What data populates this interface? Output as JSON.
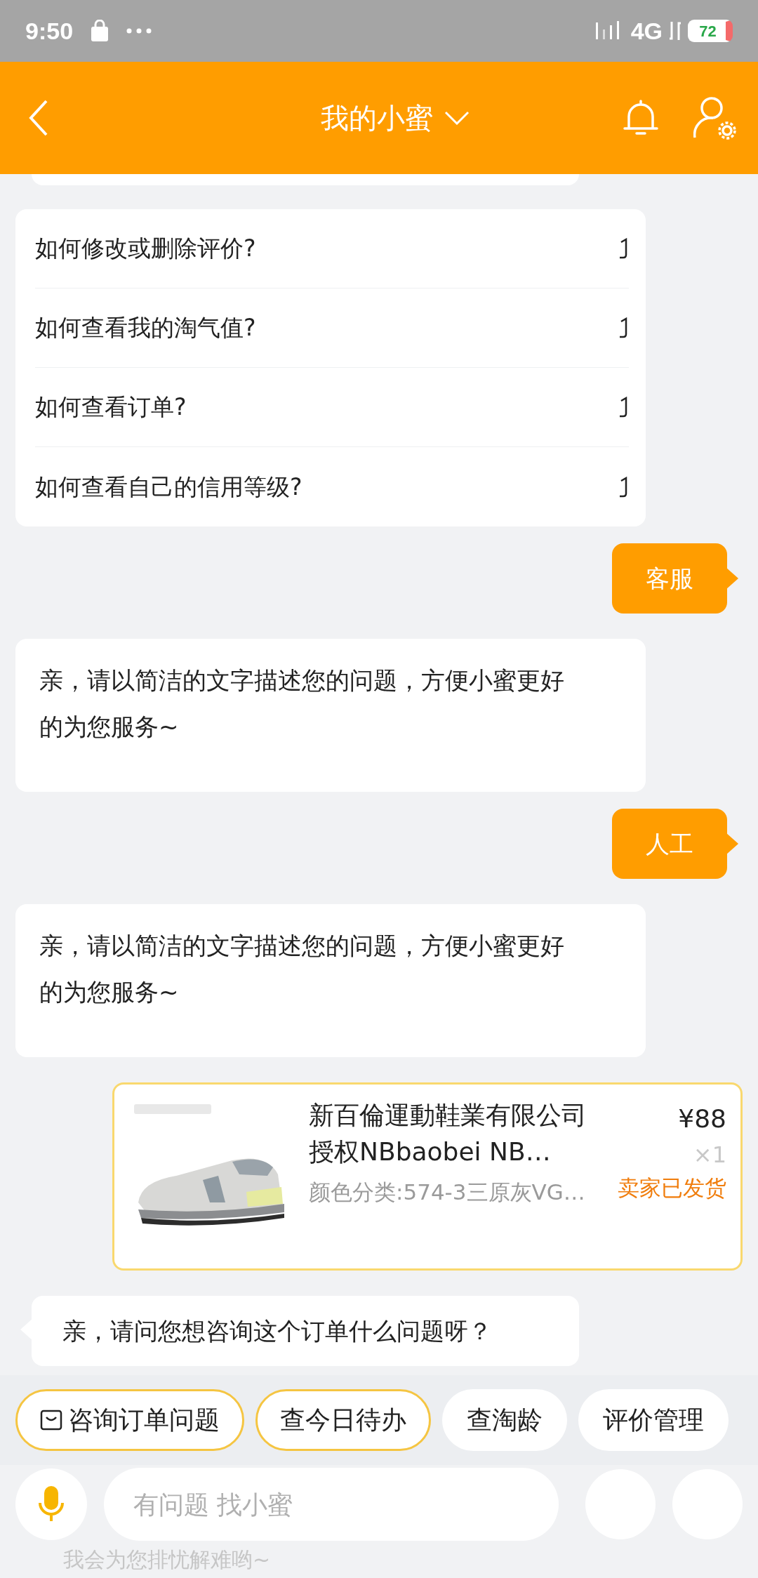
{
  "status_bar": {
    "time": "9:50",
    "network": "4G",
    "battery": "72"
  },
  "header": {
    "title": "我的小蜜"
  },
  "messages": [
    {
      "kind": "faq",
      "questions": [
        "如何修改或删除评价?",
        "如何查看我的淘气值?",
        "如何查看订单?",
        "如何查看自己的信用等级?"
      ]
    },
    {
      "kind": "user",
      "text": "客服"
    },
    {
      "kind": "bot",
      "text": "亲，请以简洁的文字描述您的问题，方便小蜜更好的为您服务~"
    },
    {
      "kind": "user",
      "text": "人工"
    },
    {
      "kind": "bot",
      "text": "亲，请以简洁的文字描述您的问题，方便小蜜更好的为您服务~"
    },
    {
      "kind": "order",
      "title": "新百倫運動鞋業有限公司授权NBbaobei NB…",
      "sku": "颜色分类:574-3三原灰VG…",
      "price": "¥88",
      "quantity": "×1",
      "status": "卖家已发货"
    },
    {
      "kind": "bot_short",
      "text": "亲，请问您想咨询这个订单什么问题呀？"
    }
  ],
  "quick_replies": [
    {
      "label": "咨询订单问题",
      "kind": "icon",
      "highlighted": true
    },
    {
      "label": "查今日待办",
      "kind": "plain",
      "highlighted": true
    },
    {
      "label": "查淘龄",
      "kind": "plain",
      "highlighted": false
    },
    {
      "label": "评价管理",
      "kind": "plain",
      "highlighted": false
    }
  ],
  "input": {
    "placeholder": "有问题 找小蜜"
  },
  "faded_text": "我会为您排忧解难哟~"
}
